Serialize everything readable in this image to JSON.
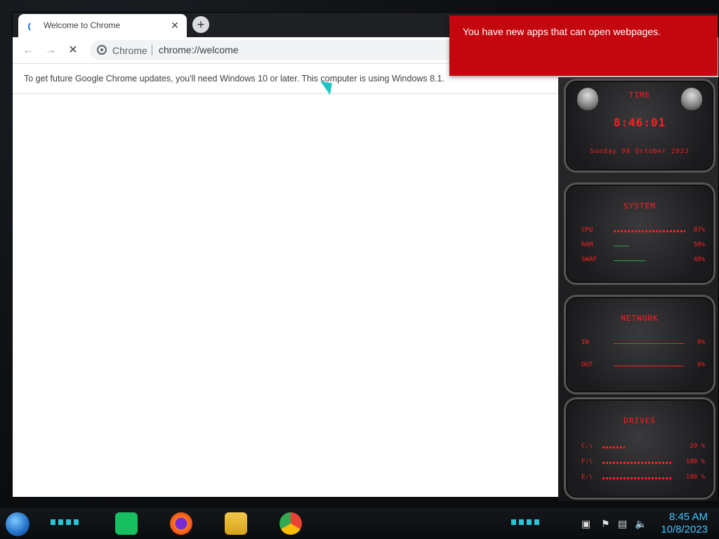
{
  "browser": {
    "tab_title": "Welcome to Chrome",
    "close_glyph": "✕",
    "new_tab_glyph": "+",
    "back_glyph": "←",
    "forward_glyph": "→",
    "stop_glyph": "✕",
    "site_chip": "Chrome",
    "url": "chrome://welcome",
    "infobar_message": "To get future Google Chrome updates, you'll need Windows 10 or later. This computer is using Windows 8.1."
  },
  "notification": {
    "text": "You have new apps that can open webpages."
  },
  "gadget": {
    "time_title": "TIME",
    "time": "8:46:01",
    "date": "Sunday 08 October 2023",
    "system_title": "SYSTEM",
    "system_rows": [
      {
        "label": "CPU",
        "value": "87%",
        "fraction": 0.87
      },
      {
        "label": "RAM",
        "value": "58%",
        "fraction": 0.58
      },
      {
        "label": "SWAP",
        "value": "48%",
        "fraction": 0.48
      }
    ],
    "network_title": "NETWORK",
    "network_rows": [
      {
        "label": "IN",
        "value": "0%"
      },
      {
        "label": "OUT",
        "value": "0%"
      }
    ],
    "drives_title": "DRIVES",
    "drive_rows": [
      {
        "label": "C:\\",
        "value": "29 %",
        "fraction": 0.29
      },
      {
        "label": "F:\\",
        "value": "100 %",
        "fraction": 1.0
      },
      {
        "label": "E:\\",
        "value": "100 %",
        "fraction": 1.0
      }
    ]
  },
  "taskbar": {
    "time": "8:45 AM",
    "date": "10/8/2023",
    "icons": [
      "start-orb-icon",
      "notes-app-icon",
      "firefox-icon",
      "file-explorer-icon",
      "chrome-icon"
    ]
  },
  "colors": {
    "notification_bg": "#c4070f",
    "gadget_red": "#ff1f1f",
    "clock_blue": "#3ec6ff"
  }
}
